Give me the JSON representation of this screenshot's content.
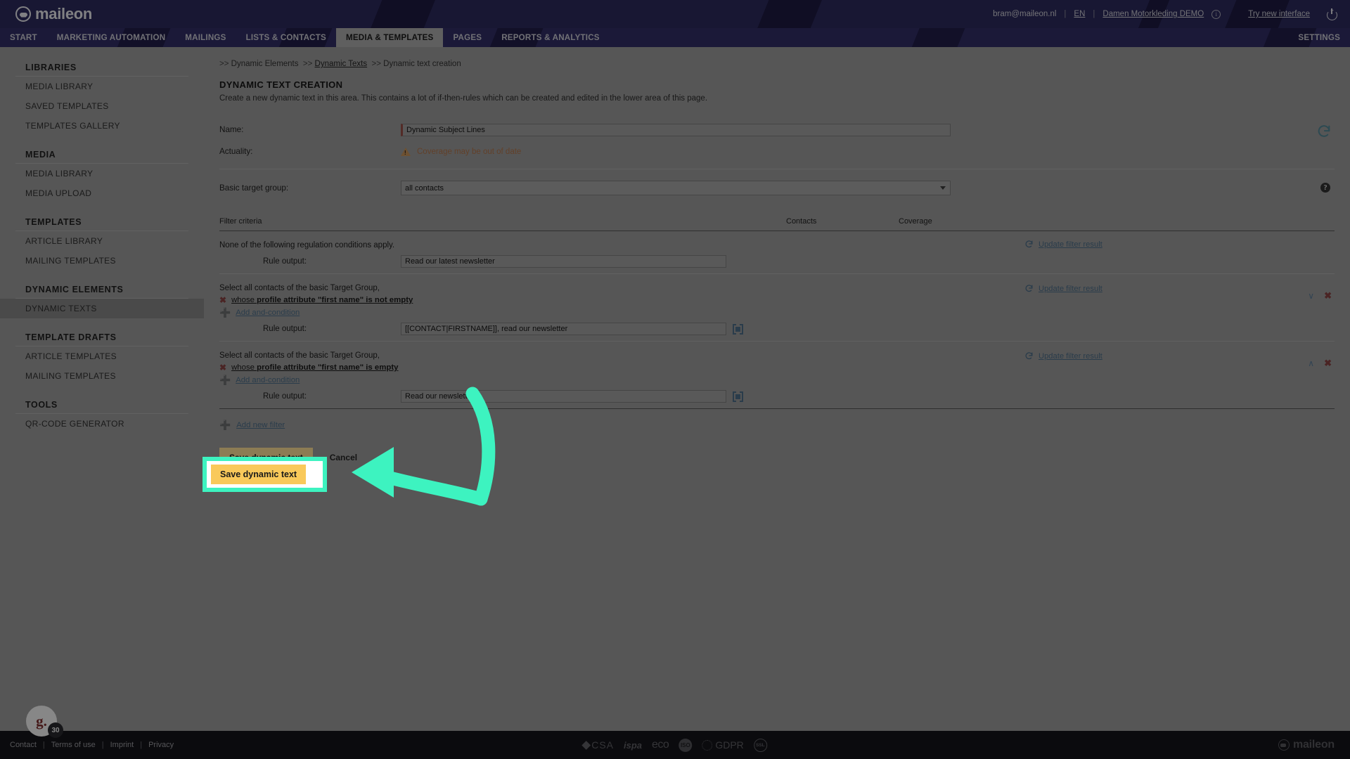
{
  "topbar": {
    "brand": "maileon",
    "user_email": "bram@maileon.nl",
    "language": "EN",
    "account": "Damen Motorkleding DEMO",
    "info_icon": "info-circle-icon",
    "try_new_interface": "Try new interface",
    "power_icon": "power-icon",
    "separator": "|"
  },
  "mainnav": {
    "items": [
      {
        "label": "START",
        "active": false
      },
      {
        "label": "MARKETING AUTOMATION",
        "active": false
      },
      {
        "label": "MAILINGS",
        "active": false
      },
      {
        "label": "LISTS & CONTACTS",
        "active": false
      },
      {
        "label": "MEDIA & TEMPLATES",
        "active": true
      },
      {
        "label": "PAGES",
        "active": false
      },
      {
        "label": "REPORTS & ANALYTICS",
        "active": false
      }
    ],
    "settings": "SETTINGS"
  },
  "sidebar": {
    "groups": [
      {
        "title": "LIBRARIES",
        "items": [
          {
            "label": "MEDIA LIBRARY",
            "active": false
          },
          {
            "label": "SAVED TEMPLATES",
            "active": false
          },
          {
            "label": "TEMPLATES GALLERY",
            "active": false
          }
        ]
      },
      {
        "title": "MEDIA",
        "items": [
          {
            "label": "MEDIA LIBRARY",
            "active": false
          },
          {
            "label": "MEDIA UPLOAD",
            "active": false
          }
        ]
      },
      {
        "title": "TEMPLATES",
        "items": [
          {
            "label": "ARTICLE LIBRARY",
            "active": false
          },
          {
            "label": "MAILING TEMPLATES",
            "active": false
          }
        ]
      },
      {
        "title": "DYNAMIC ELEMENTS",
        "items": [
          {
            "label": "DYNAMIC TEXTS",
            "active": true
          }
        ]
      },
      {
        "title": "TEMPLATE DRAFTS",
        "items": [
          {
            "label": "ARTICLE TEMPLATES",
            "active": false
          },
          {
            "label": "MAILING TEMPLATES",
            "active": false
          }
        ]
      },
      {
        "title": "TOOLS",
        "items": [
          {
            "label": "QR-CODE GENERATOR",
            "active": false
          }
        ]
      }
    ]
  },
  "breadcrumb": {
    "arrow": ">>",
    "item1": "Dynamic Elements",
    "item2": "Dynamic Texts",
    "item3": "Dynamic text creation"
  },
  "panel": {
    "title": "DYNAMIC TEXT CREATION",
    "description": "Create a new dynamic text in this area. This contains a lot of if-then-rules which can be created and edited in the lower area of this page."
  },
  "form": {
    "name_label": "Name:",
    "name_value": "Dynamic Subject Lines",
    "actuality_label": "Actuality:",
    "actuality_warning": "Coverage may be out of date",
    "warning_icon": "warning-triangle-icon",
    "refresh_icon": "refresh-icon",
    "basic_target_group_label": "Basic target group:",
    "basic_target_group_value": "all contacts",
    "help_icon": "help-circle-icon"
  },
  "table": {
    "col_filter": "Filter criteria",
    "col_contacts": "Contacts",
    "col_coverage": "Coverage",
    "update_filter_result": "Update filter result",
    "refresh_icon": "refresh-icon",
    "rule_output_label": "Rule output:",
    "add_and_condition": "Add and-condition",
    "add_new_filter": "Add new filter",
    "personalization_icon": "personalization-brackets-icon",
    "chevron_down_icon": "chevron-down-icon",
    "chevron_up_icon": "chevron-up-icon",
    "delete_icon": "delete-x-icon"
  },
  "rules": [
    {
      "headline": "None of the following regulation conditions apply.",
      "condition": "",
      "condition_bold": "",
      "output": "Read our latest newsletter",
      "has_personalization_icon": false,
      "has_add_condition": false,
      "has_condition": false,
      "chevron": "",
      "has_controls": false
    },
    {
      "headline": "Select all contacts of the basic Target Group,",
      "condition_prefix": "whose ",
      "condition_bold": "profile attribute \"first name\" is not empty",
      "output": "[[CONTACT|FIRSTNAME]], read our newsletter",
      "has_personalization_icon": true,
      "has_add_condition": true,
      "has_condition": true,
      "chevron": "∨",
      "has_controls": true
    },
    {
      "headline": "Select all contacts of the basic Target Group,",
      "condition_prefix": "whose ",
      "condition_bold": "profile attribute \"first name\" is empty",
      "output": "Read our newsletter",
      "has_personalization_icon": true,
      "has_add_condition": true,
      "has_condition": true,
      "chevron": "∧",
      "has_controls": true
    }
  ],
  "actions": {
    "save_label": "Save dynamic text",
    "cancel_label": "Cancel"
  },
  "footer": {
    "links": [
      "Contact",
      "Terms of use",
      "Imprint",
      "Privacy"
    ],
    "separator": "|",
    "badges": [
      "CSA",
      "ispa",
      "eco",
      "ISO",
      "GDPR",
      "SSL"
    ],
    "logo": "maileon"
  },
  "widget": {
    "label": "g.",
    "badge_count": "30"
  },
  "colors": {
    "brand_navy": "#262273",
    "accent_yellow": "#f7c752",
    "link_blue": "#2f6490",
    "warning_orange": "#c4601c",
    "danger_red": "#9e2f2f",
    "highlight_teal": "#3df3c0"
  }
}
